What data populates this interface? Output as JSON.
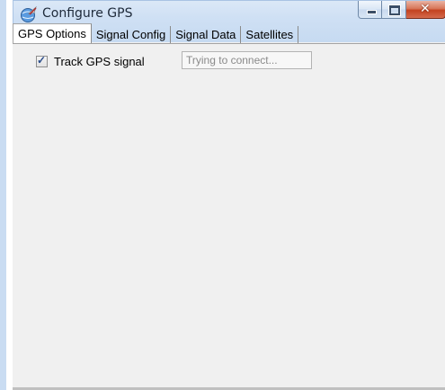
{
  "window": {
    "title": "Configure GPS",
    "icon": "gps-globe-icon"
  },
  "controls": {
    "minimize": "minimize-icon",
    "maximize": "maximize-icon",
    "close_glyph": "✕"
  },
  "tabs": [
    {
      "label": "GPS Options",
      "active": true
    },
    {
      "label": "Signal Config",
      "active": false
    },
    {
      "label": "Signal Data",
      "active": false
    },
    {
      "label": "Satellites",
      "active": false
    }
  ],
  "gps_options": {
    "track_label": "Track GPS signal",
    "track_checked": true,
    "check_glyph": "✓",
    "status_text": "Trying to connect..."
  }
}
